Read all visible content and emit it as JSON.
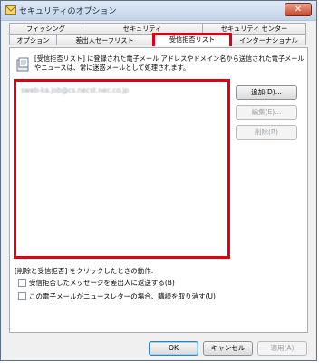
{
  "window": {
    "title": "セキュリティのオプション",
    "close_label": "✕"
  },
  "tabs_row1": [
    {
      "label": "フィッシング"
    },
    {
      "label": "セキュリティ"
    },
    {
      "label": "セキュリティ センター"
    }
  ],
  "tabs_row2": [
    {
      "label": "オプション"
    },
    {
      "label": "差出人セーフリスト"
    },
    {
      "label": "受信拒否リスト",
      "active": true
    },
    {
      "label": "インターナショナル"
    }
  ],
  "info": {
    "line1": "[受信拒否リスト] に登録された電子メール アドレスやドメイン名から送信された電子メール",
    "line2": "やニュースは、常に迷惑メールとして処理されます。"
  },
  "blocked_list": {
    "items": [
      "sweb-ka.job@cs.necst.nec.co.jp"
    ]
  },
  "side_buttons": {
    "add": "追加(D)...",
    "edit": "編集(E)...",
    "delete": "削除(R)"
  },
  "delete_options": {
    "caption": "[削除と受信拒否] をクリックしたときの動作:",
    "option1": {
      "label": "受信拒否したメッセージを差出人に返送する(B)",
      "checked": false
    },
    "option2": {
      "label": "この電子メールがニュースレターの場合、購読を取り消す(U)",
      "checked": false
    }
  },
  "footer": {
    "ok": "OK",
    "cancel": "キャンセル",
    "apply": "適用(A)"
  }
}
